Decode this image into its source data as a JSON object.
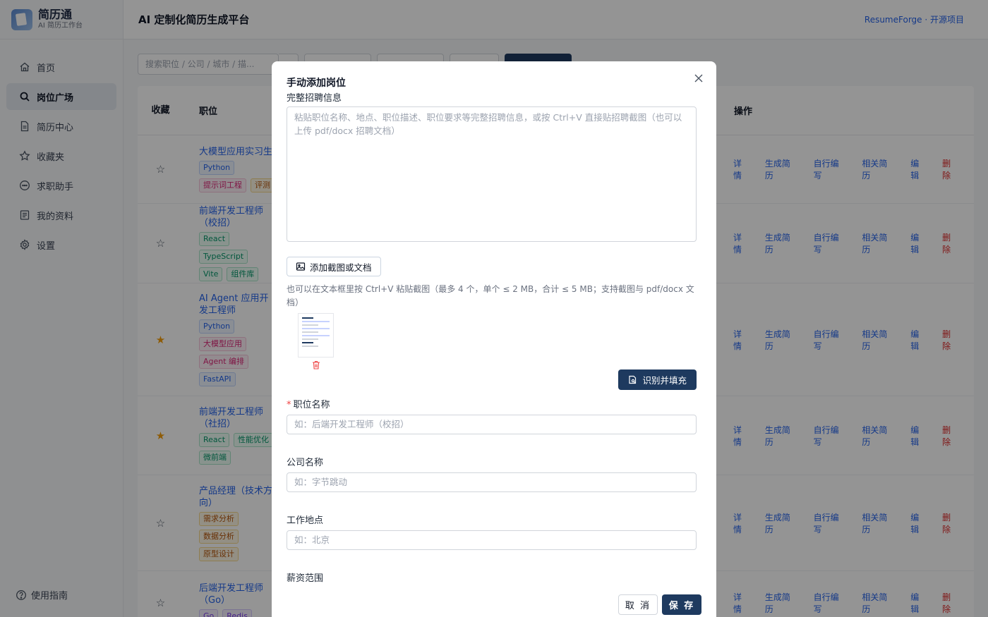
{
  "brand": {
    "name": "简历通",
    "subtitle": "AI 简历工作台"
  },
  "header": {
    "title": "AI 定制化简历生成平台",
    "link": "ResumeForge · 开源项目"
  },
  "sidebar": {
    "items": [
      {
        "label": "首页",
        "icon": "home-icon"
      },
      {
        "label": "岗位广场",
        "icon": "search-icon",
        "active": true
      },
      {
        "label": "简历中心",
        "icon": "document-icon"
      },
      {
        "label": "收藏夹",
        "icon": "star-icon"
      },
      {
        "label": "求职助手",
        "icon": "chat-icon"
      },
      {
        "label": "我的资料",
        "icon": "profile-icon"
      },
      {
        "label": "设置",
        "icon": "gear-icon"
      }
    ],
    "guide": "使用指南"
  },
  "toolbar": {
    "search_placeholder": "搜索职位 / 公司 / 城市 / 描..."
  },
  "table": {
    "headers": {
      "fav": "收藏",
      "position": "职位",
      "ops": "操作"
    },
    "ops": [
      "详情",
      "生成简历",
      "自行编写",
      "相关简历",
      "编辑",
      "删除"
    ],
    "rows": [
      {
        "title": "大模型应用实习生",
        "starred": false,
        "tags": [
          [
            "Python",
            "blue"
          ],
          [
            "提示词工程",
            "red"
          ],
          [
            "评测",
            "amber"
          ]
        ]
      },
      {
        "title": "前端开发工程师（校招）",
        "starred": false,
        "tags": [
          [
            "React",
            "green"
          ],
          [
            "TypeScript",
            "green"
          ],
          [
            "Vite",
            "green"
          ],
          [
            "组件库",
            "green"
          ]
        ]
      },
      {
        "title": "AI Agent 应用开发工程师",
        "starred": true,
        "tags": [
          [
            "Python",
            "blue"
          ],
          [
            "大模型应用",
            "red"
          ],
          [
            "Agent 编排",
            "red"
          ],
          [
            "FastAPI",
            "blue"
          ]
        ]
      },
      {
        "title": "前端开发工程师（社招）",
        "starred": true,
        "tags": [
          [
            "React",
            "green"
          ],
          [
            "性能优化",
            "green"
          ],
          [
            "微前端",
            "green"
          ]
        ]
      },
      {
        "title": "产品经理（技术方向）",
        "starred": false,
        "tags": [
          [
            "需求分析",
            "amber"
          ],
          [
            "数据分析",
            "amber"
          ],
          [
            "原型设计",
            "amber"
          ]
        ]
      },
      {
        "title": "后端开发工程师（Go）",
        "starred": false,
        "tags": [
          [
            "Go",
            "purple"
          ],
          [
            "Redis",
            "purple"
          ]
        ]
      }
    ]
  },
  "modal": {
    "title": "手动添加岗位",
    "full_info_label": "完整招聘信息",
    "textarea_placeholder": "粘贴职位名称、地点、职位描述、职位要求等完整招聘信息，或按 Ctrl+V 直接贴招聘截图（也可以上传 pdf/docx 招聘文档）",
    "attach_label": "添加截图或文档",
    "hint": "也可以在文本框里按 Ctrl+V 粘贴截图（最多 4 个，单个 ≤ 2 MB，合计 ≤ 5 MB；支持截图与 pdf/docx 文档）",
    "recognize_label": "识别并填充",
    "position_label": "职位名称",
    "position_placeholder": "如：后端开发工程师（校招）",
    "company_label": "公司名称",
    "company_placeholder": "如：字节跳动",
    "location_label": "工作地点",
    "location_placeholder": "如：北京",
    "salary_label": "薪资范围",
    "cancel_label": "取 消",
    "save_label": "保 存"
  }
}
